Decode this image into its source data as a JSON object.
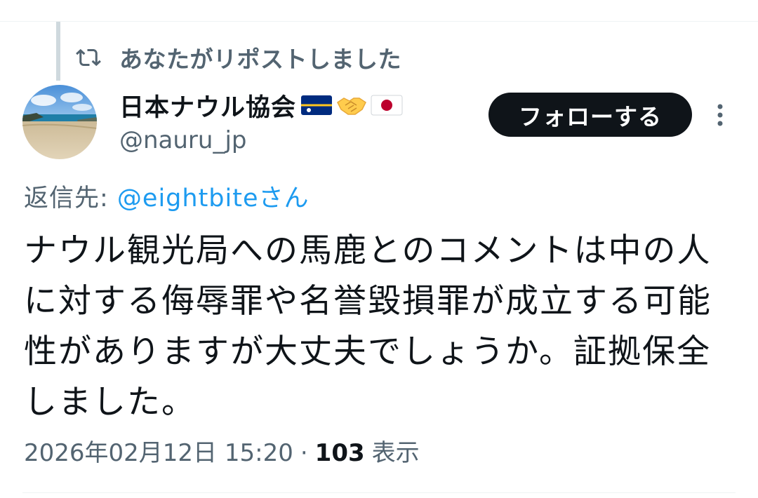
{
  "repost": {
    "text": "あなたがリポストしました"
  },
  "author": {
    "display_name": "日本ナウル協会",
    "emoji": [
      "nauru-flag",
      "handshake",
      "japan-flag"
    ],
    "handle": "@nauru_jp"
  },
  "follow_button": {
    "label": "フォローする"
  },
  "reply": {
    "prefix": "返信先: ",
    "mention": "@eightbiteさん"
  },
  "tweet": {
    "text": "ナウル観光局への馬鹿とのコメントは中の人に対する侮辱罪や名誉毀損罪が成立する可能性がありますが大丈夫でしょうか。証拠保全しました。"
  },
  "meta": {
    "timestamp": "2026年02月12日 15:20",
    "separator": "·",
    "view_count": "103",
    "view_label": "表示"
  },
  "colors": {
    "primary_text": "#0f1419",
    "secondary_text": "#536471",
    "link": "#1d9bf0",
    "follow_button_bg": "#0f1419"
  }
}
